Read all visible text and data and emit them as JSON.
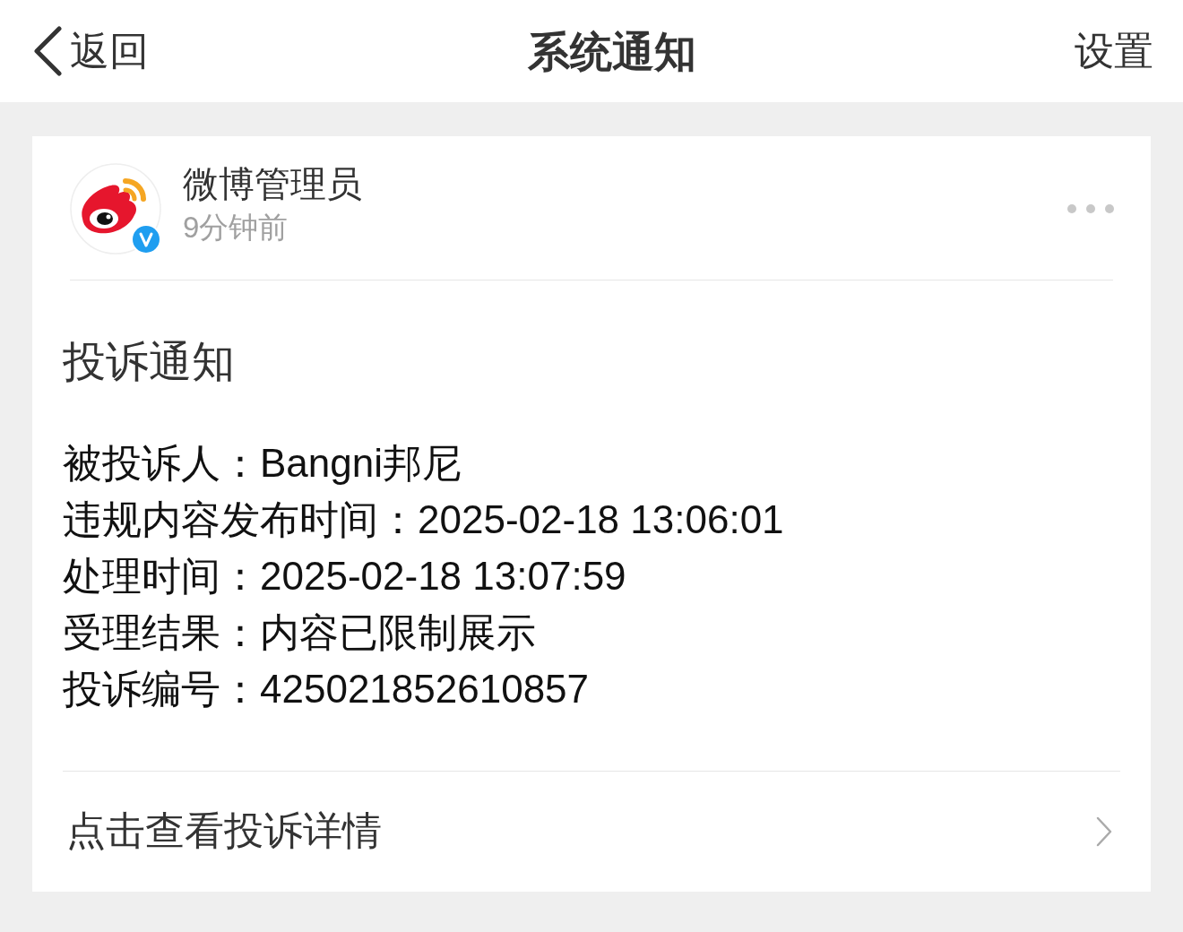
{
  "nav": {
    "back_label": "返回",
    "title": "系统通知",
    "settings_label": "设置"
  },
  "message": {
    "sender": "微博管理员",
    "verified": true,
    "time": "9分钟前",
    "title": "投诉通知",
    "fields": [
      {
        "label": "被投诉人：",
        "value": "Bangni邦尼"
      },
      {
        "label": "违规内容发布时间：",
        "value": "2025-02-18 13:06:01"
      },
      {
        "label": "处理时间：",
        "value": "2025-02-18 13:07:59"
      },
      {
        "label": "受理结果：",
        "value": "内容已限制展示"
      },
      {
        "label": "投诉编号：",
        "value": "425021852610857"
      }
    ],
    "link": "点击查看投诉详情"
  }
}
